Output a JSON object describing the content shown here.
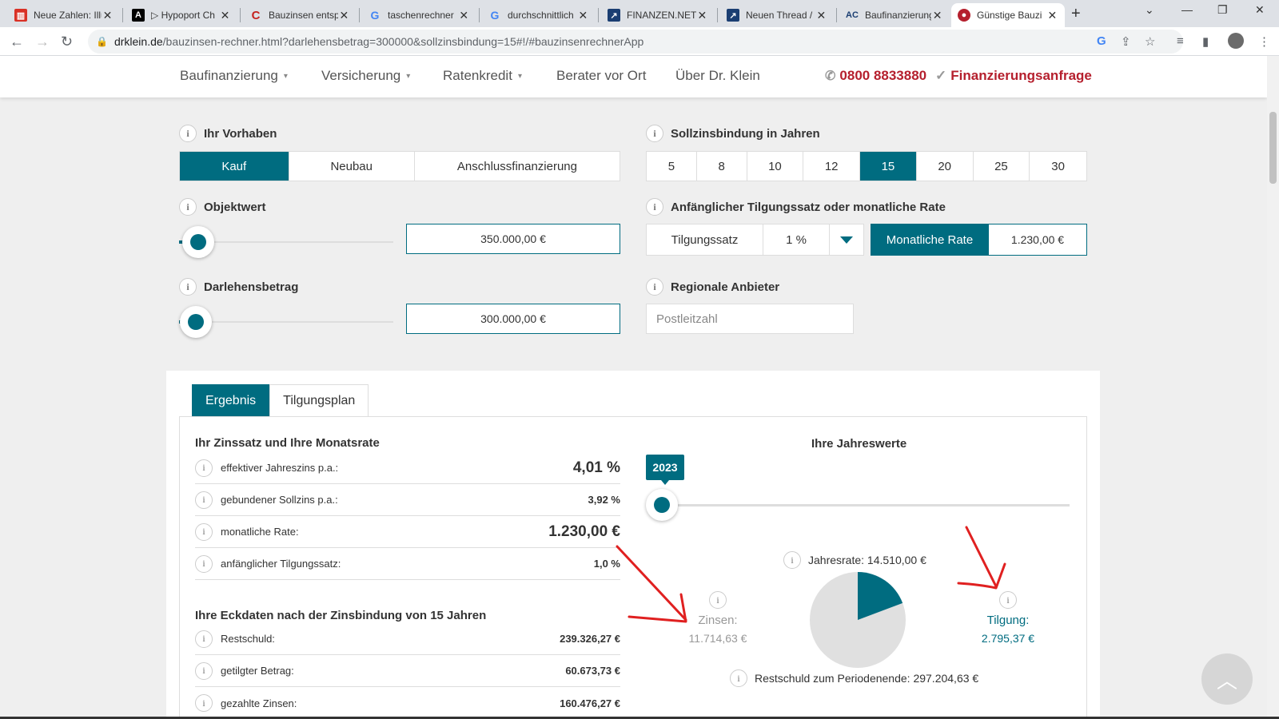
{
  "browser": {
    "tabs": [
      {
        "label": "Neue Zahlen: Illu",
        "icon": "newspaper-icon",
        "color": "#d93025"
      },
      {
        "label": "▷ Hypoport Ch",
        "icon": "a-logo-icon",
        "color": "#000000"
      },
      {
        "label": "Bauzinsen entsp",
        "icon": "c-logo-icon",
        "color": "#c5221f"
      },
      {
        "label": "taschenrechner",
        "icon": "google-icon",
        "color": "#4285f4"
      },
      {
        "label": "durchschnittlich",
        "icon": "google-icon",
        "color": "#4285f4"
      },
      {
        "label": "FINANZEN.NET",
        "icon": "chart-icon",
        "color": "#1a3e72"
      },
      {
        "label": "Neuen Thread /",
        "icon": "chart-icon",
        "color": "#1a3e72"
      },
      {
        "label": "Baufinanzierung",
        "icon": "ac-logo-icon",
        "color": "#1a3e72"
      },
      {
        "label": "Günstige Bauzi",
        "icon": "drklein-icon",
        "color": "#b51f2d"
      }
    ],
    "new_tab_label": "+",
    "url_domain": "drklein.de",
    "url_path": "/bauzinsen-rechner.html?darlehensbetrag=300000&sollzinsbindung=15#!/#bauzinsenrechnerApp"
  },
  "header": {
    "nav": [
      "Baufinanzierung",
      "Versicherung",
      "Ratenkredit",
      "Berater vor Ort",
      "Über Dr. Klein"
    ],
    "phone": "0800 8833880",
    "request": "Finanzierungsanfrage"
  },
  "form": {
    "vorhaben_label": "Ihr Vorhaben",
    "vorhaben_options": [
      "Kauf",
      "Neubau",
      "Anschlussfinanzierung"
    ],
    "vorhaben_selected": "Kauf",
    "zinsbindung_label": "Sollzinsbindung in Jahren",
    "zinsbindung_options": [
      "5",
      "8",
      "10",
      "12",
      "15",
      "20",
      "25",
      "30"
    ],
    "zinsbindung_selected": "15",
    "objektwert_label": "Objektwert",
    "objektwert_value": "350.000,00 €",
    "objektwert_slider_level": 0.09,
    "tilgung_label": "Anfänglicher Tilgungssatz oder monatliche Rate",
    "tilgungssatz_label": "Tilgungssatz",
    "tilgungssatz_value": "1 %",
    "monatliche_rate_label": "Monatliche Rate",
    "monatliche_rate_value": "1.230,00 €",
    "darlehen_label": "Darlehensbetrag",
    "darlehen_value": "300.000,00 €",
    "darlehen_slider_level": 0.08,
    "regional_label": "Regionale Anbieter",
    "plz_placeholder": "Postleitzahl"
  },
  "result": {
    "tabs": [
      "Ergebnis",
      "Tilgungsplan"
    ],
    "zins_title": "Ihr Zinssatz und Ihre Monatsrate",
    "zins_rows": [
      {
        "label": "effektiver Jahreszins p.a.:",
        "value": "4,01 %"
      },
      {
        "label": "gebundener Sollzins p.a.:",
        "value": "3,92 %"
      },
      {
        "label": "monatliche Rate:",
        "value": "1.230,00 €"
      },
      {
        "label": "anfänglicher Tilgungssatz:",
        "value": "1,0 %"
      }
    ],
    "eck_title": "Ihre Eckdaten nach der Zinsbindung von 15 Jahren",
    "eck_rows": [
      {
        "label": "Restschuld:",
        "value": "239.326,27 €"
      },
      {
        "label": "getilgter Betrag:",
        "value": "60.673,73 €"
      },
      {
        "label": "gezahlte Zinsen:",
        "value": "160.476,27 €"
      }
    ],
    "jahreswerte_title": "Ihre Jahreswerte",
    "year": "2023",
    "jahresrate": "Jahresrate: 14.510,00 €",
    "zinsen_label": "Zinsen:",
    "zinsen_value": "11.714,63 €",
    "tilgung_label": "Tilgung:",
    "tilgung_value": "2.795,37 €",
    "restschuld_periode": "Restschuld zum Periodenende: 297.204,63 €",
    "pie": {
      "zinsen": 11714.63,
      "tilgung": 2795.37,
      "zinsen_color": "#e0e0e0",
      "tilgung_color": "#006c80"
    }
  },
  "colors": {
    "accent": "#006c80",
    "brand_red": "#b51f2d",
    "annotation": "#e02020"
  }
}
